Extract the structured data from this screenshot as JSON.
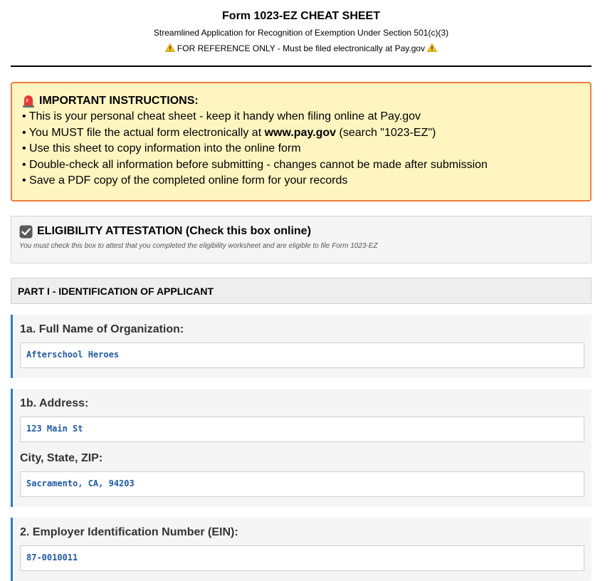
{
  "header": {
    "title": "Form 1023-EZ CHEAT SHEET",
    "subtitle": "Streamlined Application for Recognition of Exemption Under Section 501(c)(3)",
    "notice_icon": "warning-icon",
    "notice_text": " FOR REFERENCE ONLY - Must be filed electronically at Pay.gov "
  },
  "instructions": {
    "icon": "siren-icon",
    "title": "IMPORTANT INSTRUCTIONS:",
    "items": [
      "• This is your personal cheat sheet - keep it handy when filing online at Pay.gov",
      {
        "before": "• You MUST file the actual form electronically at ",
        "bold": "www.pay.gov",
        "after": " (search \"1023-EZ\")"
      },
      "• Use this sheet to copy information into the online form",
      "• Double-check all information before submitting - changes cannot be made after submission",
      "• Save a PDF copy of the completed online form for your records"
    ],
    "border_color": "#f07d3a",
    "background": "#fff5c1"
  },
  "eligibility": {
    "icon": "checkbox-checked-icon",
    "title": "ELIGIBILITY ATTESTATION (Check this box online)",
    "note": "You must check this box to attest that you completed the eligibility worksheet and are eligible to file Form 1023-EZ"
  },
  "part1": {
    "title": "PART I - IDENTIFICATION OF APPLICANT"
  },
  "fields": {
    "name": {
      "label": "1a. Full Name of Organization:",
      "value": "Afterschool Heroes"
    },
    "address": {
      "label": "1b. Address:",
      "value": "123 Main St",
      "city_label": "City, State, ZIP:",
      "city_value": "Sacramento, CA, 94203"
    },
    "ein": {
      "label": "2. Employer Identification Number (EIN):",
      "value": "87-0010011"
    }
  },
  "colors": {
    "accent_bar": "#2a7dc9",
    "value_text": "#1f5aa8"
  }
}
